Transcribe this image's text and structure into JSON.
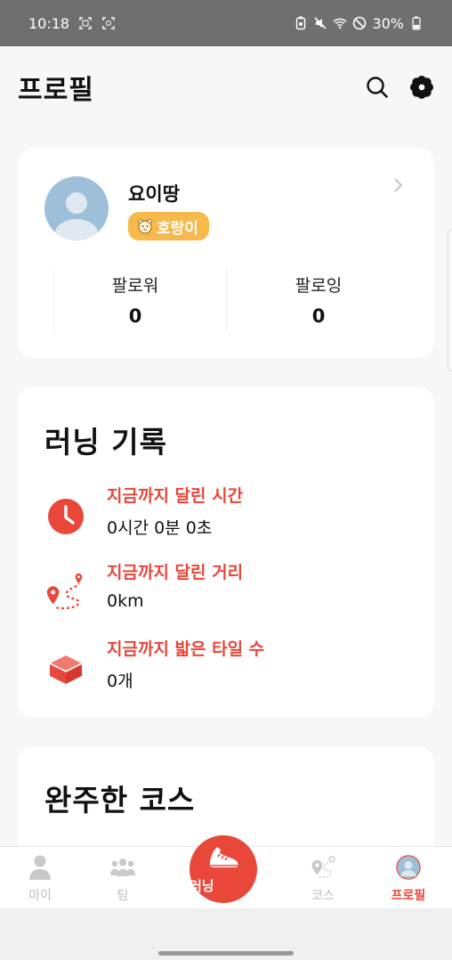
{
  "status_bar": {
    "time": "10:18",
    "battery": "30%"
  },
  "header": {
    "title": "프로필"
  },
  "profile": {
    "username": "요이땅",
    "badge": "호랑이",
    "followers_label": "팔로워",
    "followers_count": "0",
    "following_label": "팔로잉",
    "following_count": "0"
  },
  "records": {
    "title": "러닝 기록",
    "items": [
      {
        "icon": "clock-icon",
        "label": "지금까지 달린 시간",
        "value": "0시간 0분 0초"
      },
      {
        "icon": "route-icon",
        "label": "지금까지 달린 거리",
        "value": "0km"
      },
      {
        "icon": "tile-icon",
        "label": "지금까지 밟은 타일 수",
        "value": "0개"
      }
    ]
  },
  "courses": {
    "title": "완주한 코스"
  },
  "tabs": [
    {
      "icon": "person-icon",
      "label": "마이"
    },
    {
      "icon": "team-icon",
      "label": "팀"
    },
    {
      "icon": "shoe-icon",
      "label": "러닝"
    },
    {
      "icon": "course-icon",
      "label": "코스"
    },
    {
      "icon": "avatar-icon",
      "label": "프로필"
    }
  ],
  "colors": {
    "accent": "#e8473a",
    "badge": "#f7b94c",
    "avatar": "#9dbfd9"
  }
}
